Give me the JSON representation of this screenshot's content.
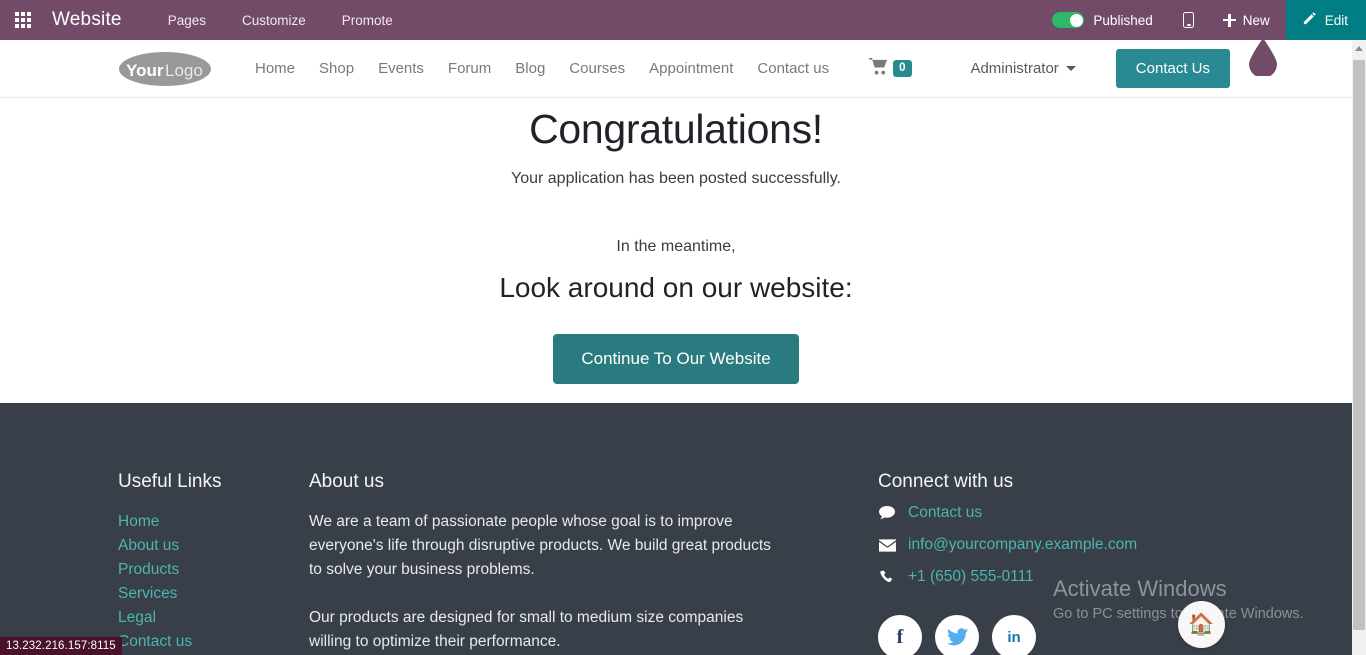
{
  "backend_bar": {
    "apps_icon": "apps-grid-icon",
    "app_name": "Website",
    "menus": [
      "Pages",
      "Customize",
      "Promote"
    ],
    "published_label": "Published",
    "published_state": true,
    "mobile_preview_icon": "mobile-device-icon",
    "new_label": "New",
    "new_icon": "plus-icon",
    "edit_label": "Edit",
    "edit_icon": "pencil-icon",
    "colors": {
      "bar": "#714B67",
      "edit": "#017e84",
      "toggle_on": "#2eb86b"
    }
  },
  "site_nav": {
    "logo_text": "YourLogo",
    "links": [
      "Home",
      "Shop",
      "Events",
      "Forum",
      "Blog",
      "Courses",
      "Appointment",
      "Contact us"
    ],
    "cart_icon": "shopping-cart-icon",
    "cart_count": "0",
    "user_name": "Administrator",
    "cta_label": "Contact Us",
    "colors": {
      "cta": "#2a8a94",
      "link": "#7a7a7a"
    }
  },
  "main": {
    "heading": "Congratulations!",
    "subtitle": "Your application has been posted successfully.",
    "meantime": "In the meantime,",
    "look_around": "Look around on our website:",
    "cta_label": "Continue To Our Website",
    "cta_color": "#2a7b80"
  },
  "footer": {
    "useful_links": {
      "title": "Useful Links",
      "items": [
        "Home",
        "About us",
        "Products",
        "Services",
        "Legal",
        "Contact us"
      ]
    },
    "about": {
      "title": "About us",
      "paragraph1": "We are a team of passionate people whose goal is to improve everyone's life through disruptive products. We build great products to solve your business problems.",
      "paragraph2": "Our products are designed for small to medium size companies willing to optimize their performance."
    },
    "connect": {
      "title": "Connect with us",
      "contact_label": "Contact us",
      "contact_icon": "comment-icon",
      "email": "info@yourcompany.example.com",
      "email_icon": "envelope-icon",
      "phone": "+1 (650) 555-0111",
      "phone_icon": "phone-icon",
      "socials": [
        {
          "name": "facebook-icon",
          "glyph": "f"
        },
        {
          "name": "twitter-icon",
          "glyph": ""
        },
        {
          "name": "linkedin-icon",
          "glyph": "in"
        }
      ]
    },
    "colors": {
      "background": "#383f48",
      "link": "#4cb5af",
      "text": "#e7e9ec"
    }
  },
  "overlays": {
    "watermark_title": "Activate Windows",
    "watermark_sub": "Go to PC settings to activate Windows.",
    "home_fab_icon": "home-icon",
    "status_url": "13.232.216.157:8115"
  }
}
